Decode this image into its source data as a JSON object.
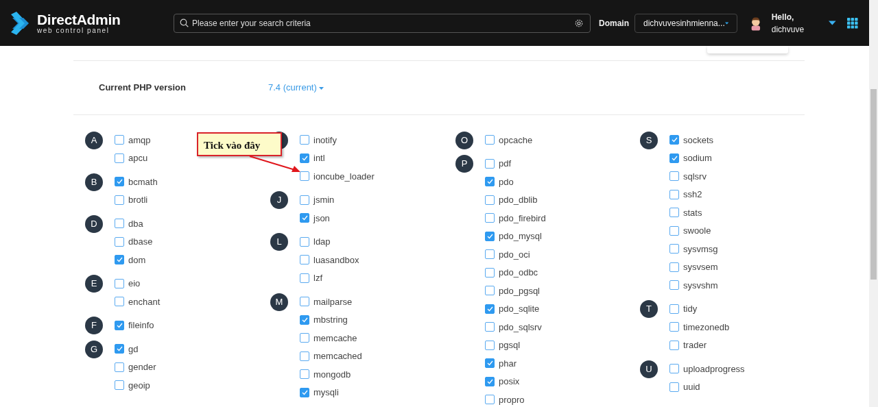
{
  "header": {
    "logo": {
      "title": "DirectAdmin",
      "subtitle": "web control panel"
    },
    "search": {
      "placeholder": "Please enter your search criteria"
    },
    "domain": {
      "label": "Domain",
      "value": "dichvuvesinhmienna..."
    },
    "user": {
      "greeting": "Hello,",
      "name": "dichvuve"
    }
  },
  "php_version": {
    "label": "Current PHP version",
    "value": "7.4 (current)"
  },
  "callout": {
    "text": "Tick vào đây"
  },
  "columns": [
    [
      {
        "letter": "A",
        "extensions": [
          {
            "name": "amqp",
            "checked": false
          },
          {
            "name": "apcu",
            "checked": false
          }
        ]
      },
      {
        "letter": "B",
        "extensions": [
          {
            "name": "bcmath",
            "checked": true
          },
          {
            "name": "brotli",
            "checked": false
          }
        ]
      },
      {
        "letter": "D",
        "extensions": [
          {
            "name": "dba",
            "checked": false
          },
          {
            "name": "dbase",
            "checked": false
          },
          {
            "name": "dom",
            "checked": true
          }
        ]
      },
      {
        "letter": "E",
        "extensions": [
          {
            "name": "eio",
            "checked": false
          },
          {
            "name": "enchant",
            "checked": false
          }
        ]
      },
      {
        "letter": "F",
        "extensions": [
          {
            "name": "fileinfo",
            "checked": true
          }
        ]
      },
      {
        "letter": "G",
        "extensions": [
          {
            "name": "gd",
            "checked": true
          },
          {
            "name": "gender",
            "checked": false
          },
          {
            "name": "geoip",
            "checked": false
          }
        ]
      }
    ],
    [
      {
        "extensions": [
          {
            "name": "inotify",
            "checked": false
          },
          {
            "name": "intl",
            "checked": true
          },
          {
            "name": "ioncube_loader",
            "checked": false
          }
        ]
      },
      {
        "letter": "J",
        "extensions": [
          {
            "name": "jsmin",
            "checked": false
          },
          {
            "name": "json",
            "checked": true
          }
        ]
      },
      {
        "letter": "L",
        "extensions": [
          {
            "name": "ldap",
            "checked": false
          },
          {
            "name": "luasandbox",
            "checked": false
          },
          {
            "name": "lzf",
            "checked": false
          }
        ]
      },
      {
        "letter": "M",
        "extensions": [
          {
            "name": "mailparse",
            "checked": false
          },
          {
            "name": "mbstring",
            "checked": true
          },
          {
            "name": "memcache",
            "checked": false
          },
          {
            "name": "memcached",
            "checked": false
          },
          {
            "name": "mongodb",
            "checked": false
          },
          {
            "name": "mysqli",
            "checked": true
          }
        ]
      }
    ],
    [
      {
        "letter": "O",
        "extensions": [
          {
            "name": "opcache",
            "checked": false
          }
        ]
      },
      {
        "letter": "P",
        "extensions": [
          {
            "name": "pdf",
            "checked": false
          },
          {
            "name": "pdo",
            "checked": true
          },
          {
            "name": "pdo_dblib",
            "checked": false
          },
          {
            "name": "pdo_firebird",
            "checked": false
          },
          {
            "name": "pdo_mysql",
            "checked": true
          },
          {
            "name": "pdo_oci",
            "checked": false
          },
          {
            "name": "pdo_odbc",
            "checked": false
          },
          {
            "name": "pdo_pgsql",
            "checked": false
          },
          {
            "name": "pdo_sqlite",
            "checked": true
          },
          {
            "name": "pdo_sqlsrv",
            "checked": false
          },
          {
            "name": "pgsql",
            "checked": false
          },
          {
            "name": "phar",
            "checked": true
          },
          {
            "name": "posix",
            "checked": true
          },
          {
            "name": "propro",
            "checked": false
          }
        ]
      }
    ],
    [
      {
        "letter": "S",
        "extensions": [
          {
            "name": "sockets",
            "checked": true
          },
          {
            "name": "sodium",
            "checked": true
          },
          {
            "name": "sqlsrv",
            "checked": false
          },
          {
            "name": "ssh2",
            "checked": false
          },
          {
            "name": "stats",
            "checked": false
          },
          {
            "name": "swoole",
            "checked": false
          },
          {
            "name": "sysvmsg",
            "checked": false
          },
          {
            "name": "sysvsem",
            "checked": false
          },
          {
            "name": "sysvshm",
            "checked": false
          }
        ]
      },
      {
        "letter": "T",
        "extensions": [
          {
            "name": "tidy",
            "checked": false
          },
          {
            "name": "timezonedb",
            "checked": false
          },
          {
            "name": "trader",
            "checked": false
          }
        ]
      },
      {
        "letter": "U",
        "extensions": [
          {
            "name": "uploadprogress",
            "checked": false
          },
          {
            "name": "uuid",
            "checked": false
          }
        ]
      }
    ]
  ]
}
